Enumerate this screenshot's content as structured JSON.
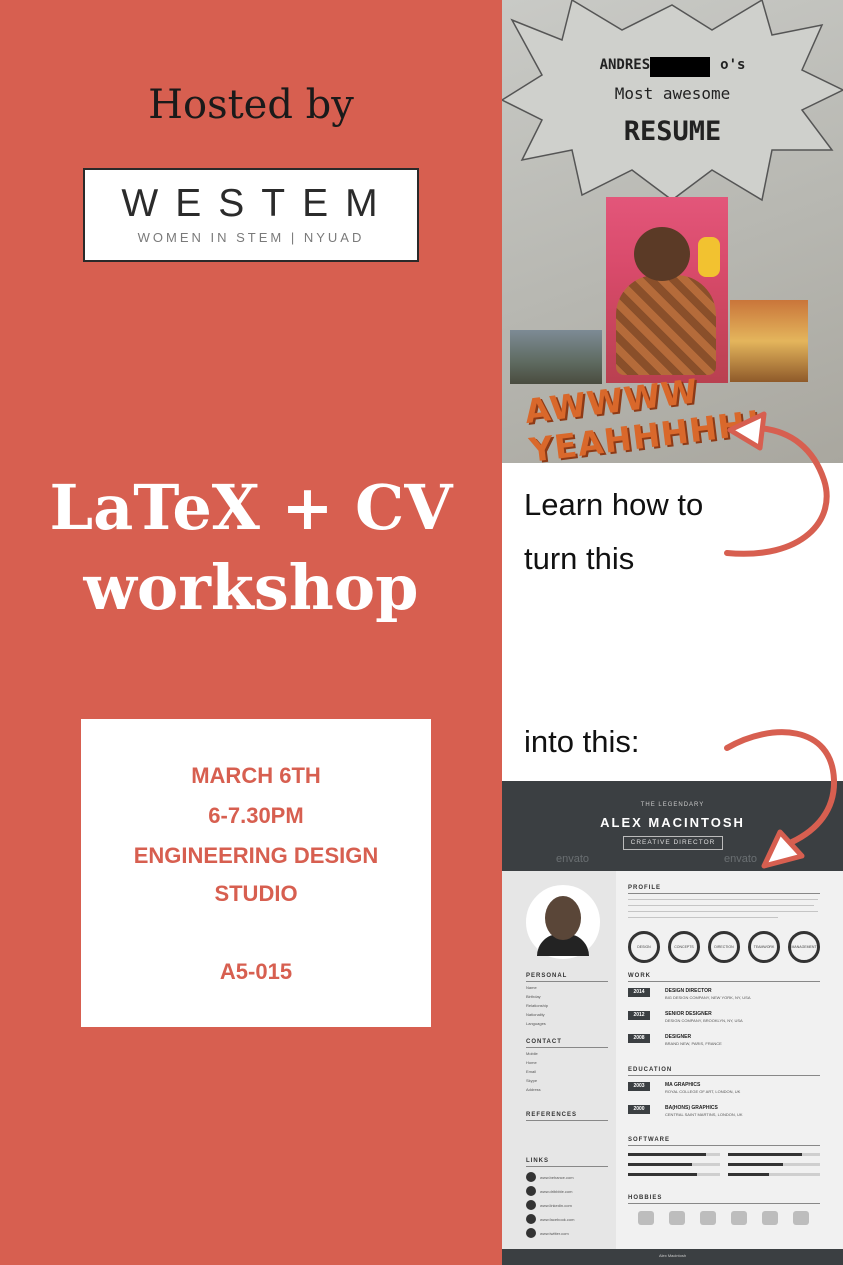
{
  "hosted_by": "Hosted by",
  "logo": {
    "name": "WESTEM",
    "tagline": "WOMEN IN STEM | NYUAD"
  },
  "title": {
    "line1": "LaTeX + CV",
    "line2": "workshop"
  },
  "details": {
    "date": "MARCH 6TH",
    "time": "6-7.30PM",
    "venue_line1": "ENGINEERING DESIGN",
    "venue_line2": "STUDIO",
    "room": "A5-015"
  },
  "old_resume": {
    "line1": "ANDRES",
    "line1_suffix": "o's",
    "line2": "Most awesome",
    "line3": "RESUME",
    "banner": "AWWWW YEAHHHHH!"
  },
  "caption_turn": {
    "line1": "Learn how to",
    "line2": "turn this"
  },
  "caption_into": "into this:",
  "new_resume": {
    "kicker": "THE LEGENDARY",
    "name": "ALEX MACINTOSH",
    "role": "CREATIVE DIRECTOR",
    "watermark": "envato",
    "sections": {
      "profile": "PROFILE",
      "work": "WORK",
      "education": "EDUCATION",
      "software": "SOFTWARE",
      "hobbies": "HOBBIES",
      "personal": "PERSONAL",
      "contact": "CONTACT",
      "references": "REFERENCES",
      "links": "LINKS"
    },
    "skills": [
      "DESIGN",
      "CONCEPTS",
      "DIRECTION",
      "TEAMWORK",
      "MANAGEMENT"
    ],
    "work": [
      {
        "year": "2014",
        "title": "DESIGN DIRECTOR",
        "place": "BIG DESIGN COMPANY, NEW YORK, NY, USA"
      },
      {
        "year": "2012",
        "title": "SENIOR DESIGNER",
        "place": "DESIGN COMPANY, BROOKLYN, NY, USA"
      },
      {
        "year": "2008",
        "title": "DESIGNER",
        "place": "BRAND NEW, PARIS, FRANCE"
      }
    ],
    "education": [
      {
        "year": "2003",
        "title": "MA GRAPHICS",
        "place": "ROYAL COLLEGE OF ART, LONDON, UK"
      },
      {
        "year": "2000",
        "title": "BA(HONS) GRAPHICS",
        "place": "CENTRAL SAINT MARTINS, LONDON, UK"
      }
    ],
    "software_levels": [
      0.85,
      0.8,
      0.7,
      0.6,
      0.75,
      0.45
    ],
    "personal_labels": [
      "Name",
      "Birthday",
      "Relationship",
      "Nationality",
      "Languages"
    ],
    "contact_labels": [
      "Mobile",
      "Home",
      "Email",
      "Skype",
      "Address"
    ],
    "links": [
      "www.behance.com",
      "www.dribbble.com",
      "www.linkedin.com",
      "www.facebook.com",
      "www.twitter.com"
    ],
    "hobbies": [
      "OUTDOORS",
      "FOOTBALL",
      "BASKETBALL",
      "WRITING",
      "MOVIES",
      "GAMES"
    ],
    "footer": "Alex Macintosh"
  },
  "colors": {
    "accent": "#d75f50",
    "dark": "#3b3f42",
    "text": "#1a1a1a"
  }
}
